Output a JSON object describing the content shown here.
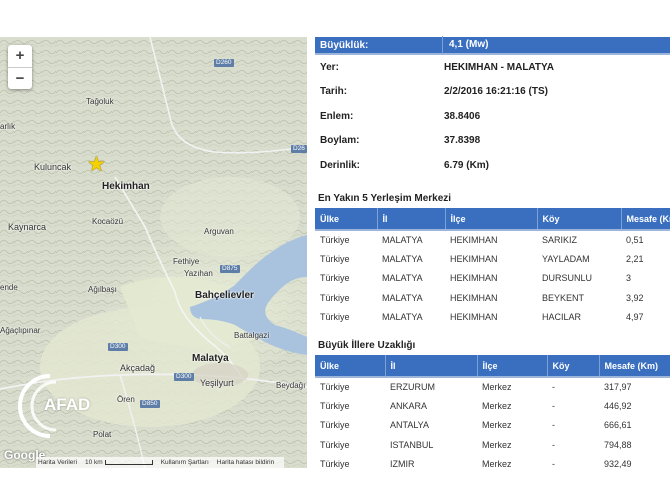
{
  "map": {
    "zoom_in": "+",
    "zoom_out": "−",
    "places": [
      {
        "key": "tagoluk",
        "label": "Tağoluk"
      },
      {
        "key": "arlik",
        "label": "arlık"
      },
      {
        "key": "kuluncak",
        "label": "Kuluncak"
      },
      {
        "key": "hekimhan",
        "label": "Hekimhan"
      },
      {
        "key": "kaynarca",
        "label": "Kaynarca"
      },
      {
        "key": "kocaozu",
        "label": "Kocaözü"
      },
      {
        "key": "arguvan",
        "label": "Arguvan"
      },
      {
        "key": "fethiye",
        "label": "Fethiye"
      },
      {
        "key": "yazihan",
        "label": "Yazıhan"
      },
      {
        "key": "ende",
        "label": "ende"
      },
      {
        "key": "agilbasi",
        "label": "Ağılbaşı"
      },
      {
        "key": "bahcelievler",
        "label": "Bahçelievler"
      },
      {
        "key": "agiludpinar",
        "label": "Ağaçlıpınar"
      },
      {
        "key": "battalgazi",
        "label": "Battalgazi"
      },
      {
        "key": "malatya",
        "label": "Malatya"
      },
      {
        "key": "akcadag",
        "label": "Akçadağ"
      },
      {
        "key": "yesilyurt",
        "label": "Yeşilyurt"
      },
      {
        "key": "beydagi",
        "label": "Beydağı"
      },
      {
        "key": "oren",
        "label": "Ören"
      },
      {
        "key": "polat",
        "label": "Polat"
      }
    ],
    "roads": {
      "d260a": "D260",
      "d260b": "D26",
      "d875": "D875",
      "d300a": "D300",
      "d300b": "D300",
      "d850": "D850"
    },
    "logo": "AFAD",
    "google": "Google",
    "attribution": {
      "map_data": "Harita Verileri",
      "scale": "10 km",
      "terms": "Kullanım Şartları",
      "report": "Harita hatası bildirin"
    }
  },
  "info": {
    "rows": [
      {
        "label": "Büyüklük:",
        "value": "4,1 (Mw)"
      },
      {
        "label": "Yer:",
        "value": "HEKIMHAN - MALATYA"
      },
      {
        "label": "Tarih:",
        "value": "2/2/2016 16:21:16 (TS)"
      },
      {
        "label": "Enlem:",
        "value": "38.8406"
      },
      {
        "label": "Boylam:",
        "value": "37.8398"
      },
      {
        "label": "Derinlik:",
        "value": "6.79 (Km)"
      }
    ]
  },
  "nearest": {
    "title": "En Yakın 5 Yerleşim Merkezi",
    "headers": [
      "Ülke",
      "İl",
      "İlçe",
      "Köy",
      "Mesafe (Km)"
    ],
    "rows": [
      [
        "Türkiye",
        "MALATYA",
        "HEKIMHAN",
        "SARIKIZ",
        "0,51"
      ],
      [
        "Türkiye",
        "MALATYA",
        "HEKIMHAN",
        "YAYLADAM",
        "2,21"
      ],
      [
        "Türkiye",
        "MALATYA",
        "HEKIMHAN",
        "DURSUNLU",
        "3"
      ],
      [
        "Türkiye",
        "MALATYA",
        "HEKIMHAN",
        "BEYKENT",
        "3,92"
      ],
      [
        "Türkiye",
        "MALATYA",
        "HEKIMHAN",
        "HACILAR",
        "4,97"
      ]
    ]
  },
  "cities": {
    "title": "Büyük İllere Uzaklığı",
    "headers": [
      "Ülke",
      "İl",
      "İlçe",
      "Köy",
      "Mesafe (Km)"
    ],
    "rows": [
      [
        "Türkiye",
        "ERZURUM",
        "Merkez",
        "-",
        "317,97"
      ],
      [
        "Türkiye",
        "ANKARA",
        "Merkez",
        "-",
        "446,92"
      ],
      [
        "Türkiye",
        "ANTALYA",
        "Merkez",
        "-",
        "666,61"
      ],
      [
        "Türkiye",
        "ISTANBUL",
        "Merkez",
        "-",
        "794,88"
      ],
      [
        "Türkiye",
        "IZMIR",
        "Merkez",
        "-",
        "932,49"
      ]
    ]
  },
  "colors": {
    "header_blue": "#3a6fbf",
    "star": "#f6d100",
    "water": "#a9c3df"
  }
}
